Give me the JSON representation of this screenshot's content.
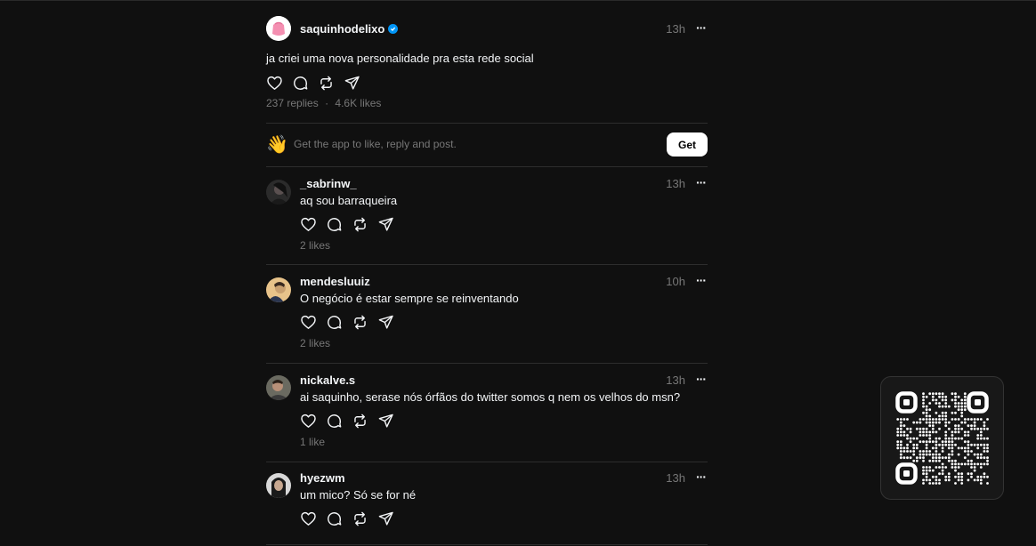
{
  "main_post": {
    "username": "saquinhodelixo",
    "verified": true,
    "time": "13h",
    "more": "···",
    "text": "ja criei uma nova personalidade pra esta rede social",
    "replies": "237 replies",
    "separator": "·",
    "likes": "4.6K likes"
  },
  "cta": {
    "emoji": "👋",
    "text": "Get the app to like, reply and post.",
    "button": "Get"
  },
  "replies": [
    {
      "username": "_sabrinw_",
      "time": "13h",
      "text": "aq sou barraqueira",
      "likes": "2 likes"
    },
    {
      "username": "mendesluuiz",
      "time": "10h",
      "text": "O negócio é estar sempre se reinventando",
      "likes": "2 likes"
    },
    {
      "username": "nickalve.s",
      "time": "13h",
      "text": "ai saquinho, serase nós órfãos do twitter somos q nem os velhos do msn?",
      "likes": "1 like"
    },
    {
      "username": "hyezwm",
      "time": "13h",
      "text": "um mico? Só se for né",
      "likes": ""
    }
  ],
  "colors": {
    "background": "#101010",
    "text": "#f3f5f7",
    "secondary": "#777777",
    "verified": "#0095f6"
  },
  "icons": [
    "heart-icon",
    "comment-icon",
    "repost-icon",
    "share-icon",
    "verified-badge-icon",
    "qr-code"
  ]
}
